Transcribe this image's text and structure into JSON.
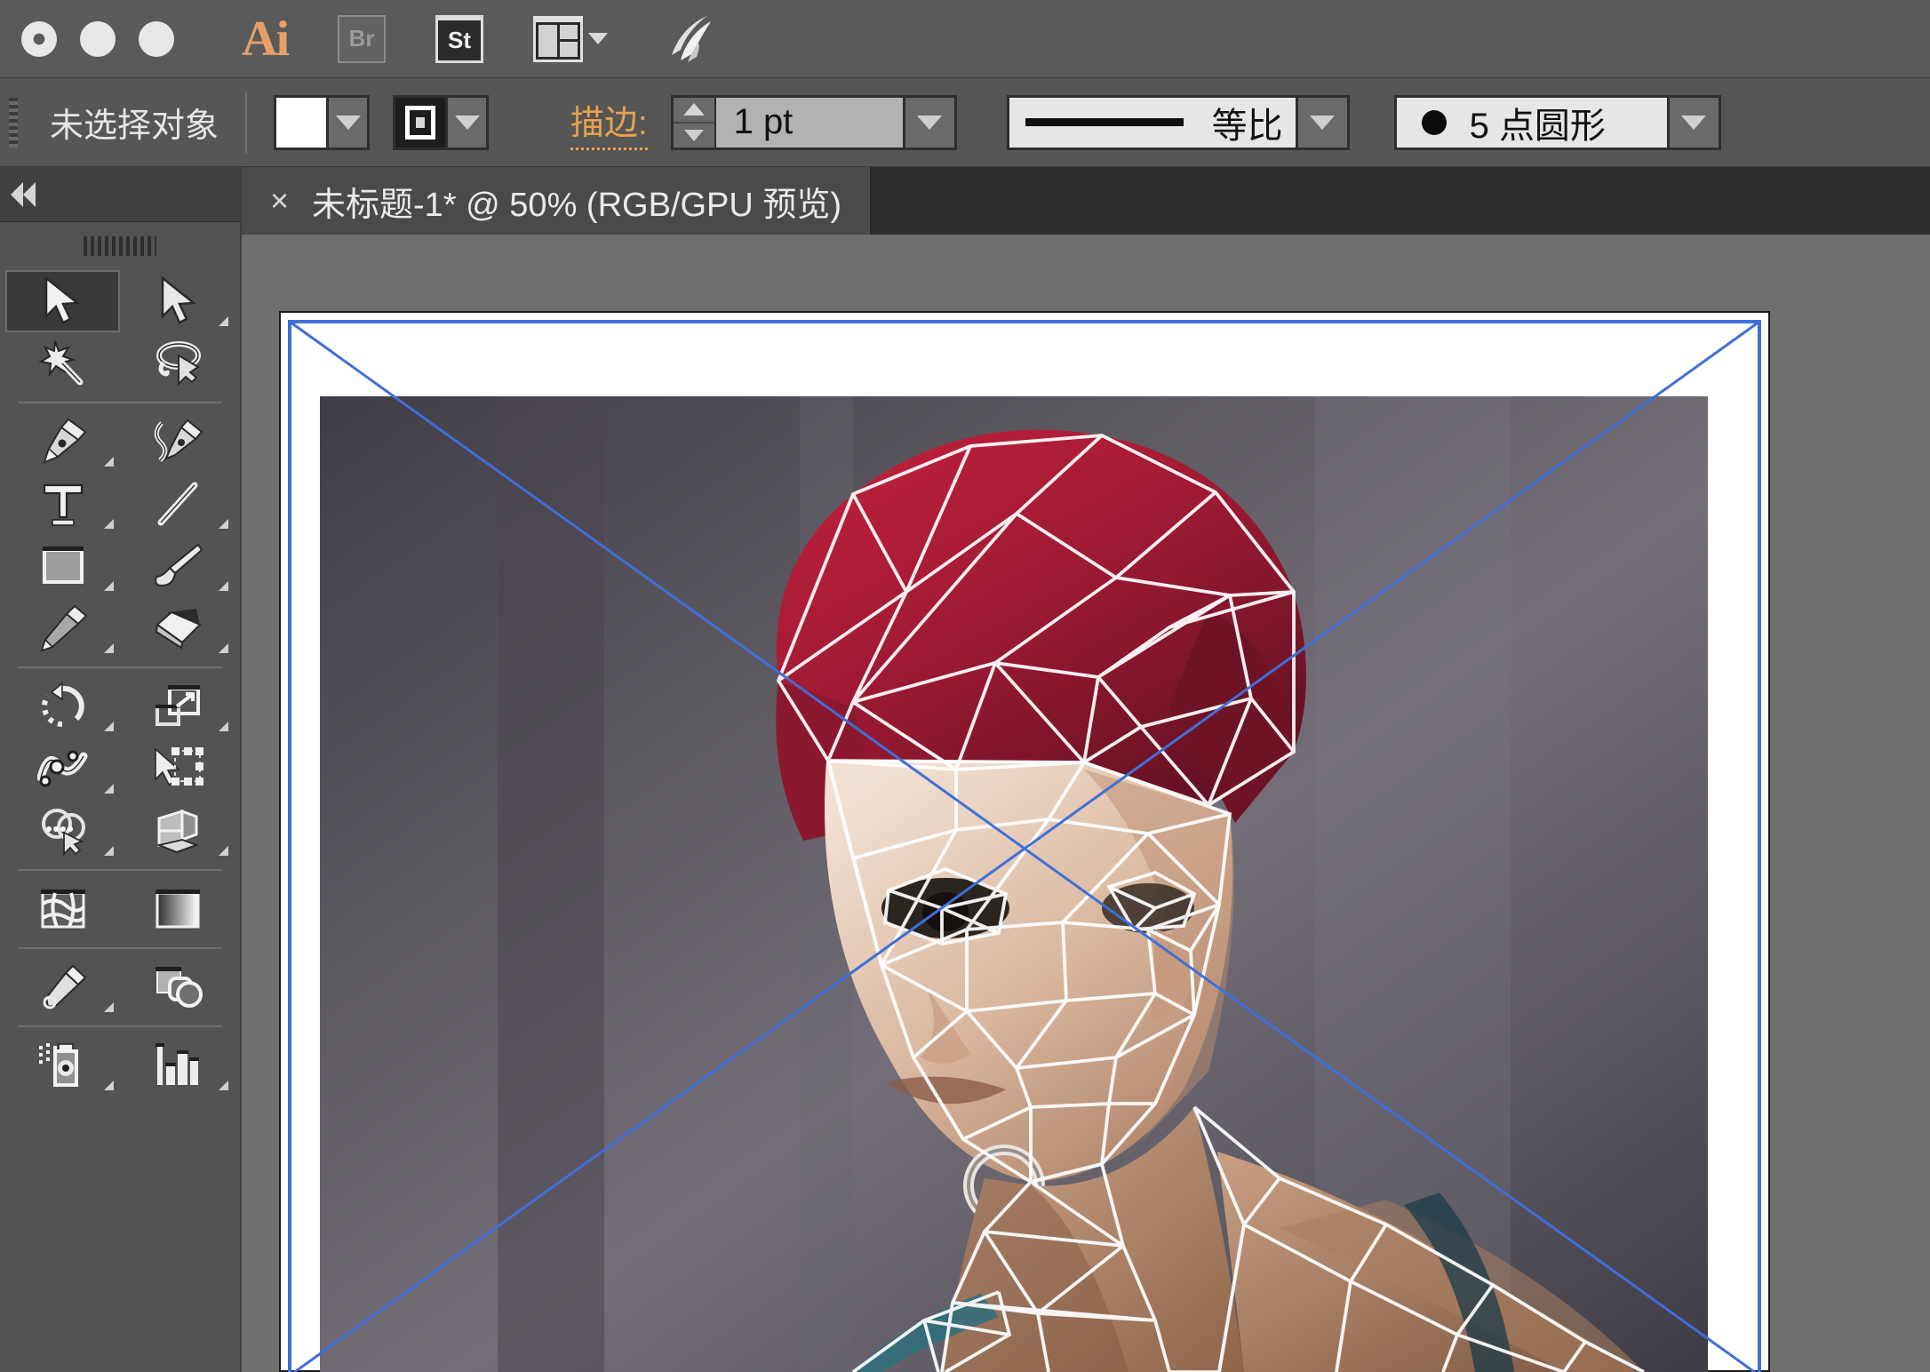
{
  "app_bar": {
    "window_controls": [
      "close",
      "minimize",
      "zoom"
    ],
    "logo_label": "Ai",
    "items": [
      {
        "name": "bridge-button",
        "label": "Br"
      },
      {
        "name": "stock-button",
        "label": "St"
      },
      {
        "name": "arrange-documents-button",
        "label": ""
      },
      {
        "name": "discover-button",
        "label": ""
      }
    ]
  },
  "control_bar": {
    "selection_status": "未选择对象",
    "fill": {
      "label": "fill-swatch",
      "color": "#ffffff"
    },
    "stroke_swatch": {
      "label": "stroke-swatch",
      "color": "#1d1d1d"
    },
    "stroke_label": "描边:",
    "stroke_label_color": "#e8a24e",
    "stroke_weight": "1 pt",
    "stroke_profile": "等比",
    "brush_definition": "5 点圆形"
  },
  "tool_panel": {
    "collapse_label": "collapse-panel",
    "tools": [
      {
        "name": "selection-tool",
        "active": true,
        "corner": false
      },
      {
        "name": "direct-selection-tool",
        "active": false,
        "corner": true
      },
      {
        "name": "magic-wand-tool",
        "active": false,
        "corner": false
      },
      {
        "name": "lasso-tool",
        "active": false,
        "corner": false
      },
      {
        "name": "pen-tool",
        "active": false,
        "corner": true
      },
      {
        "name": "curvature-tool",
        "active": false,
        "corner": false
      },
      {
        "name": "type-tool",
        "active": false,
        "corner": true
      },
      {
        "name": "line-segment-tool",
        "active": false,
        "corner": true
      },
      {
        "name": "rectangle-tool",
        "active": false,
        "corner": true
      },
      {
        "name": "paintbrush-tool",
        "active": false,
        "corner": true
      },
      {
        "name": "pencil-tool",
        "active": false,
        "corner": true
      },
      {
        "name": "eraser-tool",
        "active": false,
        "corner": true
      },
      {
        "name": "rotate-tool",
        "active": false,
        "corner": true
      },
      {
        "name": "scale-tool",
        "active": false,
        "corner": true
      },
      {
        "name": "width-tool",
        "active": false,
        "corner": true
      },
      {
        "name": "free-transform-tool",
        "active": false,
        "corner": false
      },
      {
        "name": "shape-builder-tool",
        "active": false,
        "corner": true
      },
      {
        "name": "perspective-grid-tool",
        "active": false,
        "corner": true
      },
      {
        "name": "mesh-tool",
        "active": false,
        "corner": false
      },
      {
        "name": "gradient-tool",
        "active": false,
        "corner": false
      },
      {
        "name": "eyedropper-tool",
        "active": false,
        "corner": true
      },
      {
        "name": "blend-tool",
        "active": false,
        "corner": false
      },
      {
        "name": "symbol-sprayer-tool",
        "active": false,
        "corner": true
      },
      {
        "name": "column-graph-tool",
        "active": false,
        "corner": true
      }
    ]
  },
  "document": {
    "tab_close": "×",
    "tab_title": "未标题-1* @ 50% (RGB/GPU 预览)",
    "zoom_level": "50%",
    "color_mode": "RGB",
    "preview_mode": "GPU 预览"
  },
  "canvas": {
    "artboard_border_color": "#3f6fd8",
    "artboard_fill": "#ffffff",
    "canvas_background": "#6e6e6e",
    "artwork_description": "low-poly-triangulated-portrait"
  }
}
